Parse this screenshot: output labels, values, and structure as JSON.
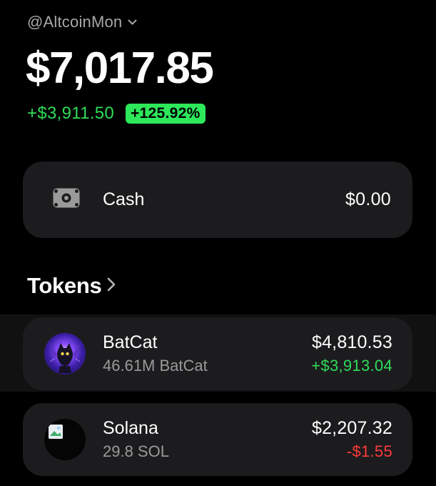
{
  "account": {
    "handle": "@AltcoinMon",
    "chevron_icon": "chevron-down-icon"
  },
  "portfolio": {
    "balance": "$7,017.85",
    "change_amount": "+$3,911.50",
    "change_percent": "+125.92%"
  },
  "cash": {
    "icon": "banknote-icon",
    "label": "Cash",
    "value": "$0.00"
  },
  "tokens_section": {
    "title": "Tokens",
    "chevron_icon": "chevron-right-icon"
  },
  "tokens": [
    {
      "name": "BatCat",
      "quantity": "46.61M BatCat",
      "value": "$4,810.53",
      "change": "+$3,913.04",
      "icon": "batcat-token-avatar"
    },
    {
      "name": "Solana",
      "quantity": "29.8 SOL",
      "value": "$2,207.32",
      "change": "-$1.55",
      "icon": "solana-token-avatar"
    }
  ],
  "colors": {
    "background": "#000000",
    "card": "#1c1c1e",
    "positive": "#2fdc5a",
    "negative": "#ff3b3b",
    "badge": "#2ce85a",
    "muted_text": "#9a9a9a"
  }
}
